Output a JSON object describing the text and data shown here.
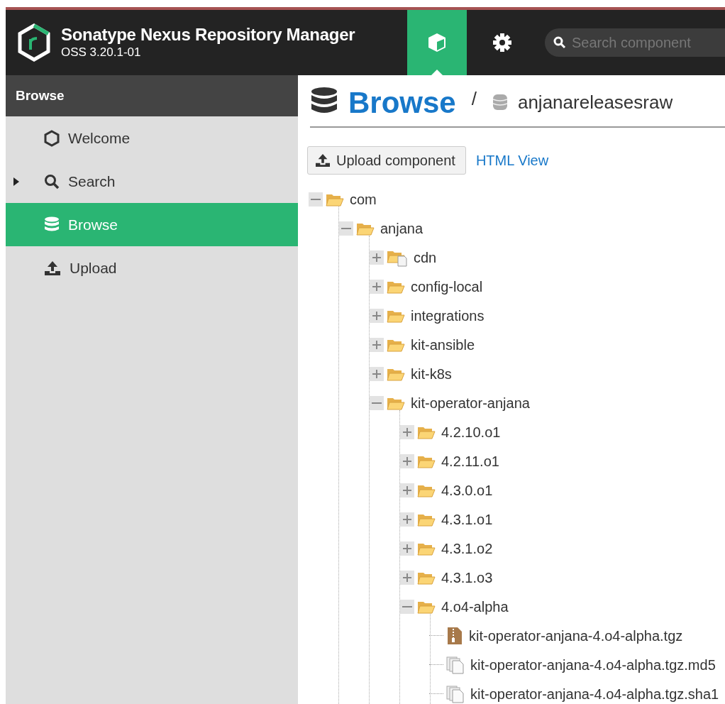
{
  "header": {
    "title": "Sonatype Nexus Repository Manager",
    "version": "OSS 3.20.1-01",
    "modes": [
      {
        "kind": "browse",
        "selected": true
      },
      {
        "kind": "admin",
        "selected": false
      }
    ],
    "search": {
      "placeholder": "Search component"
    }
  },
  "sidebar": {
    "title": "Browse",
    "items": [
      {
        "label": "Welcome",
        "kind": "hexagon",
        "expandable": false,
        "selected": false
      },
      {
        "label": "Search",
        "kind": "search",
        "expandable": true,
        "selected": false
      },
      {
        "label": "Browse",
        "kind": "database",
        "expandable": false,
        "selected": true
      },
      {
        "label": "Upload",
        "kind": "upload",
        "expandable": false,
        "selected": false
      }
    ]
  },
  "main": {
    "title": "Browse",
    "separator": "/",
    "repository": "anjanareleasesraw",
    "toolbar": {
      "upload_button": "Upload component",
      "html_view_link": "HTML View"
    },
    "tree": [
      {
        "label": "com",
        "kind": "folder",
        "expanded": true,
        "children": [
          {
            "label": "anjana",
            "kind": "folder",
            "expanded": true,
            "children": [
              {
                "label": "cdn",
                "kind": "folder-doc",
                "expanded": false
              },
              {
                "label": "config-local",
                "kind": "folder",
                "expanded": false
              },
              {
                "label": "integrations",
                "kind": "folder",
                "expanded": false
              },
              {
                "label": "kit-ansible",
                "kind": "folder",
                "expanded": false
              },
              {
                "label": "kit-k8s",
                "kind": "folder",
                "expanded": false
              },
              {
                "label": "kit-operator-anjana",
                "kind": "folder",
                "expanded": true,
                "children": [
                  {
                    "label": "4.2.10.o1",
                    "kind": "folder",
                    "expanded": false
                  },
                  {
                    "label": "4.2.11.o1",
                    "kind": "folder",
                    "expanded": false
                  },
                  {
                    "label": "4.3.0.o1",
                    "kind": "folder",
                    "expanded": false
                  },
                  {
                    "label": "4.3.1.o1",
                    "kind": "folder",
                    "expanded": false
                  },
                  {
                    "label": "4.3.1.o2",
                    "kind": "folder",
                    "expanded": false
                  },
                  {
                    "label": "4.3.1.o3",
                    "kind": "folder",
                    "expanded": false
                  },
                  {
                    "label": "4.o4-alpha",
                    "kind": "folder",
                    "expanded": true,
                    "children": [
                      {
                        "label": "kit-operator-anjana-4.o4-alpha.tgz",
                        "kind": "archive"
                      },
                      {
                        "label": "kit-operator-anjana-4.o4-alpha.tgz.md5",
                        "kind": "file"
                      },
                      {
                        "label": "kit-operator-anjana-4.o4-alpha.tgz.sha1",
                        "kind": "file"
                      }
                    ]
                  }
                ]
              }
            ]
          }
        ]
      }
    ]
  }
}
